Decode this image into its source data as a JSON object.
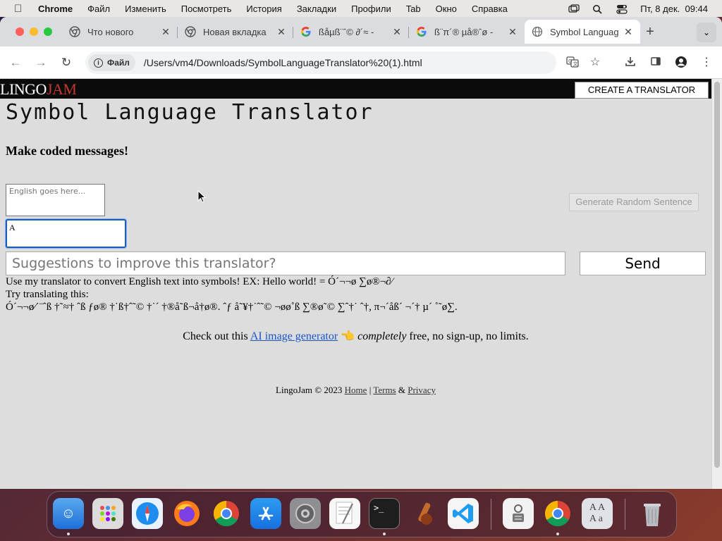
{
  "menubar": {
    "app": "Chrome",
    "items": [
      "Файл",
      "Изменить",
      "Посмотреть",
      "История",
      "Закладки",
      "Профили",
      "Tab",
      "Окно",
      "Справка"
    ],
    "datetime": "Пт, 8 дек.  09:44"
  },
  "tabs": [
    {
      "title": "Что нового",
      "icon": "chrome-icon"
    },
    {
      "title": "Новая вкладка",
      "icon": "chrome-icon"
    },
    {
      "title": "ßåµß¨ˆ© ∂´≈ - ",
      "icon": "google-icon"
    },
    {
      "title": "ß¨π´® µå®ˆø - ",
      "icon": "google-icon"
    },
    {
      "title": "Symbol Languag",
      "icon": "globe-icon",
      "active": true
    }
  ],
  "address": {
    "chip": "Файл",
    "url": "/Users/vm4/Downloads/SymbolLanguageTranslator%20(1).html"
  },
  "site": {
    "logo_part1": "LINGO",
    "logo_part2": "JAM",
    "create_button": "CREATE A TRANSLATOR"
  },
  "translator": {
    "title": "Symbol Language Translator",
    "subtitle": "Make coded messages!",
    "english_placeholder": "English goes here...",
    "symbol_value": "A",
    "generate_button": "Generate Random Sentence",
    "suggestion_placeholder": "Suggestions to improve this translator?",
    "send_button": "Send",
    "description": "Use my translator to convert English text into symbols! EX: Hello world! = Ó´¬¬ø ∑ø®¬∂⁄",
    "try_label": "Try translating this:",
    "try_text": "Ó´¬¬ø⁄˙¨ˆß †˜≈† ˆß ƒø® †˙ß†ˆ˜© †˙´ †®å˜ß¬å†ø®. ˆƒ å˜¥†˙ˆ˜© ¬øø˚ß ∑®ø˜© ∑ˆ†˙ ˆ†, π¬´åß´ ¬´† µ´ ˚˜ø∑."
  },
  "promo": {
    "prefix": "Check out this",
    "link": "AI image generator",
    "emoji": "👈",
    "emphasis": "completely",
    "suffix": "free, no sign-up, no limits."
  },
  "footer": {
    "copyright": "LingoJam © 2023",
    "home": "Home",
    "terms": "Terms",
    "privacy": "Privacy"
  },
  "dock": [
    "Finder",
    "Launchpad",
    "Safari",
    "Firefox",
    "Chrome",
    "App Store",
    "System Settings",
    "TextEdit",
    "Terminal",
    "Instruments",
    "VS Code",
    "Automator",
    "Chrome",
    "Dictionary",
    "Trash"
  ]
}
